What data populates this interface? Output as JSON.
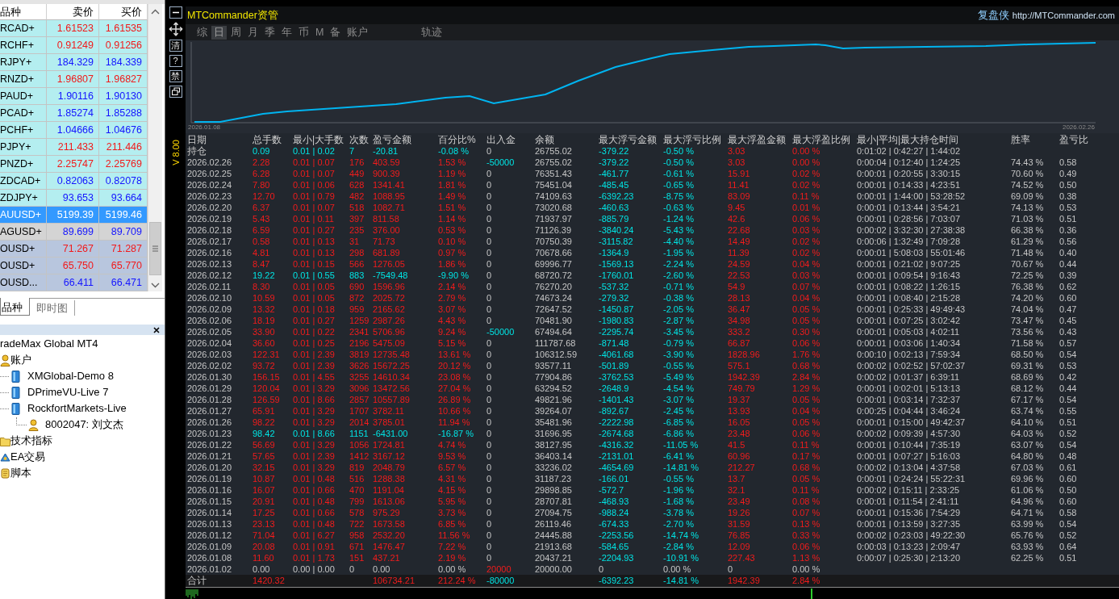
{
  "market_watch": {
    "columns": [
      "品种",
      "卖价",
      "买价"
    ],
    "rows": [
      {
        "symbol": "RCAD+",
        "bid": "1.61523",
        "ask": "1.61535",
        "rising": false,
        "color": "#b4eef0",
        "selected": false
      },
      {
        "symbol": "RCHF+",
        "bid": "0.91249",
        "ask": "0.91256",
        "rising": false,
        "color": "#b4eef0",
        "selected": false
      },
      {
        "symbol": "RJPY+",
        "bid": "184.329",
        "ask": "184.339",
        "rising": true,
        "color": "#b4eef0",
        "selected": false
      },
      {
        "symbol": "RNZD+",
        "bid": "1.96807",
        "ask": "1.96827",
        "rising": false,
        "color": "#b4eef0",
        "selected": false
      },
      {
        "symbol": "PAUD+",
        "bid": "1.90116",
        "ask": "1.90130",
        "rising": true,
        "color": "#b4eef0",
        "selected": false
      },
      {
        "symbol": "PCAD+",
        "bid": "1.85274",
        "ask": "1.85288",
        "rising": true,
        "color": "#b4eef0",
        "selected": false
      },
      {
        "symbol": "PCHF+",
        "bid": "1.04666",
        "ask": "1.04676",
        "rising": true,
        "color": "#b4eef0",
        "selected": false
      },
      {
        "symbol": "PJPY+",
        "bid": "211.433",
        "ask": "211.446",
        "rising": false,
        "color": "#b4eef0",
        "selected": false
      },
      {
        "symbol": "PNZD+",
        "bid": "2.25747",
        "ask": "2.25769",
        "rising": false,
        "color": "#b4eef0",
        "selected": false
      },
      {
        "symbol": "ZDCAD+",
        "bid": "0.82063",
        "ask": "0.82078",
        "rising": true,
        "color": "#b4eef0",
        "selected": false
      },
      {
        "symbol": "ZDJPY+",
        "bid": "93.653",
        "ask": "93.664",
        "rising": true,
        "color": "#b4eef0",
        "selected": false
      },
      {
        "symbol": "AUUSD+",
        "bid": "5199.39",
        "ask": "5199.46",
        "rising": true,
        "selected": true
      },
      {
        "symbol": "AGUSD+",
        "bid": "89.699",
        "ask": "89.709",
        "rising": true,
        "color": "#d4d4d4",
        "selected": false
      },
      {
        "symbol": "OUSD+",
        "bid": "71.267",
        "ask": "71.287",
        "rising": false,
        "color": "#b8c6de",
        "selected": false
      },
      {
        "symbol": "OUSD+",
        "bid": "65.750",
        "ask": "65.770",
        "rising": false,
        "color": "#b8c6de",
        "selected": false
      },
      {
        "symbol": "OUSD...",
        "bid": "66.411",
        "ask": "66.471",
        "rising": true,
        "color": "#b8c6de",
        "selected": false
      }
    ]
  },
  "market_tabs": [
    {
      "label": "品种",
      "selected": true
    },
    {
      "label": "即时图",
      "selected": false
    }
  ],
  "navigator": {
    "items": [
      {
        "label": "radeMax Global MT4",
        "children": [
          {
            "label": "账户",
            "kind": "accounts",
            "children": [
              {
                "label": "XMGlobal-Demo 8",
                "kind": "server"
              },
              {
                "label": "DPrimeVU-Live 7",
                "kind": "server"
              },
              {
                "label": "RockfortMarkets-Live",
                "kind": "server",
                "children": [
                  {
                    "label": "8002047: 刘文杰",
                    "kind": "account"
                  }
                ]
              }
            ]
          },
          {
            "label": "技术指标",
            "kind": "indicators"
          },
          {
            "label": "EA交易",
            "kind": "experts"
          },
          {
            "label": "脚本",
            "kind": "scripts"
          }
        ]
      }
    ]
  },
  "chart_window": {
    "toolbar": [
      {
        "kind": "minimize"
      },
      {
        "kind": "move"
      },
      {
        "kind": "text",
        "label": "清"
      },
      {
        "kind": "text",
        "label": "?"
      },
      {
        "kind": "text",
        "label": "禁"
      },
      {
        "kind": "restore"
      }
    ],
    "version": "V 8.00",
    "panel": {
      "title": "MTCommander资管",
      "brand": "复盘侠",
      "url": "http://MTCommander.com",
      "tabs": [
        {
          "label": "综",
          "selected": false
        },
        {
          "label": "日",
          "selected": true
        },
        {
          "label": "周",
          "selected": false
        },
        {
          "label": "月",
          "selected": false
        },
        {
          "label": "季",
          "selected": false
        },
        {
          "label": "年",
          "selected": false
        },
        {
          "label": "币",
          "selected": false
        },
        {
          "label": "M",
          "selected": false
        },
        {
          "label": "备",
          "selected": false
        },
        {
          "label": "账户",
          "selected": false
        },
        {
          "label": "轨迹",
          "selected": false
        }
      ],
      "chart": {
        "start_label": "2026.01.08",
        "end_label": "2026.02.26"
      },
      "table": {
        "columns": [
          "日期",
          "总手数",
          "最小|大手数",
          "次数",
          "盈亏金额",
          "百分比%",
          "出入金",
          "余额",
          "最大浮亏金额",
          "最大浮亏比例",
          "最大浮盈金额",
          "最大浮盈比例",
          "最小|平均|最大持仓时间",
          "胜率",
          "盈亏比"
        ],
        "rows": [
          {
            "date": "持仓",
            "kind": "loss",
            "lots": "0.09",
            "lots_range": "0.01 | 0.02",
            "trades": "7",
            "pnl": "-20.81",
            "pnl_pct": "-0.08 %",
            "flow": {
              "value": "0",
              "kind": "zero"
            },
            "balance": "26755.02",
            "max_loss": "-379.22",
            "max_loss_pct": "-0.50 %",
            "max_profit": "3.03",
            "max_profit_pct": "0.00 %",
            "hold_time": "0:01:02 | 0:42:27 | 1:44:02"
          },
          {
            "date": "2026.02.26",
            "kind": "profit",
            "lots": "2.28",
            "lots_range": "0.01 | 0.07",
            "trades": "176",
            "pnl": "403.59",
            "pnl_pct": "1.53 %",
            "flow": {
              "value": "-50000",
              "kind": "out"
            },
            "balance": "26755.02",
            "max_loss": "-379.22",
            "max_loss_pct": "-0.50 %",
            "max_profit": "3.03",
            "max_profit_pct": "0.00 %",
            "hold_time": "0:00:04 | 0:12:40 | 1:24:25",
            "win_rate": "74.43 %",
            "pl_ratio": "0.58"
          },
          {
            "date": "2026.02.25",
            "kind": "profit",
            "lots": "6.28",
            "lots_range": "0.01 | 0.07",
            "trades": "449",
            "pnl": "900.39",
            "pnl_pct": "1.19 %",
            "flow": {
              "value": "0",
              "kind": "zero"
            },
            "balance": "76351.43",
            "max_loss": "-461.77",
            "max_loss_pct": "-0.61 %",
            "max_profit": "15.91",
            "max_profit_pct": "0.02 %",
            "hold_time": "0:00:01 | 0:20:55 | 3:30:15",
            "win_rate": "70.60 %",
            "pl_ratio": "0.49"
          },
          {
            "date": "2026.02.24",
            "kind": "profit",
            "lots": "7.80",
            "lots_range": "0.01 | 0.06",
            "trades": "628",
            "pnl": "1341.41",
            "pnl_pct": "1.81 %",
            "flow": {
              "value": "0",
              "kind": "zero"
            },
            "balance": "75451.04",
            "max_loss": "-485.45",
            "max_loss_pct": "-0.65 %",
            "max_profit": "11.41",
            "max_profit_pct": "0.02 %",
            "hold_time": "0:00:01 | 0:14:33 | 4:23:51",
            "win_rate": "74.52 %",
            "pl_ratio": "0.50"
          },
          {
            "date": "2026.02.23",
            "kind": "profit",
            "lots": "12.70",
            "lots_range": "0.01 | 0.79",
            "trades": "482",
            "pnl": "1088.95",
            "pnl_pct": "1.49 %",
            "flow": {
              "value": "0",
              "kind": "zero"
            },
            "balance": "74109.63",
            "max_loss": "-6392.23",
            "max_loss_pct": "-8.75 %",
            "max_profit": "83.09",
            "max_profit_pct": "0.11 %",
            "hold_time": "0:00:01 | 1:44:00 | 53:28:52",
            "win_rate": "69.09 %",
            "pl_ratio": "0.38"
          },
          {
            "date": "2026.02.20",
            "kind": "profit",
            "lots": "6.37",
            "lots_range": "0.01 | 0.07",
            "trades": "518",
            "pnl": "1082.71",
            "pnl_pct": "1.51 %",
            "flow": {
              "value": "0",
              "kind": "zero"
            },
            "balance": "73020.68",
            "max_loss": "-460.63",
            "max_loss_pct": "-0.63 %",
            "max_profit": "9.45",
            "max_profit_pct": "0.01 %",
            "hold_time": "0:00:01 | 0:13:44 | 3:54:21",
            "win_rate": "74.13 %",
            "pl_ratio": "0.53"
          },
          {
            "date": "2026.02.19",
            "kind": "profit",
            "lots": "5.43",
            "lots_range": "0.01 | 0.11",
            "trades": "397",
            "pnl": "811.58",
            "pnl_pct": "1.14 %",
            "flow": {
              "value": "0",
              "kind": "zero"
            },
            "balance": "71937.97",
            "max_loss": "-885.79",
            "max_loss_pct": "-1.24 %",
            "max_profit": "42.6",
            "max_profit_pct": "0.06 %",
            "hold_time": "0:00:01 | 0:28:56 | 7:03:07",
            "win_rate": "71.03 %",
            "pl_ratio": "0.51"
          },
          {
            "date": "2026.02.18",
            "kind": "profit",
            "lots": "6.59",
            "lots_range": "0.01 | 0.27",
            "trades": "235",
            "pnl": "376.00",
            "pnl_pct": "0.53 %",
            "flow": {
              "value": "0",
              "kind": "zero"
            },
            "balance": "71126.39",
            "max_loss": "-3840.24",
            "max_loss_pct": "-5.43 %",
            "max_profit": "22.68",
            "max_profit_pct": "0.03 %",
            "hold_time": "0:00:02 | 3:32:30 | 27:38:38",
            "win_rate": "66.38 %",
            "pl_ratio": "0.36"
          },
          {
            "date": "2026.02.17",
            "kind": "profit",
            "lots": "0.58",
            "lots_range": "0.01 | 0.13",
            "trades": "31",
            "pnl": "71.73",
            "pnl_pct": "0.10 %",
            "flow": {
              "value": "0",
              "kind": "zero"
            },
            "balance": "70750.39",
            "max_loss": "-3115.82",
            "max_loss_pct": "-4.40 %",
            "max_profit": "14.49",
            "max_profit_pct": "0.02 %",
            "hold_time": "0:00:06 | 1:32:49 | 7:09:28",
            "win_rate": "61.29 %",
            "pl_ratio": "0.56"
          },
          {
            "date": "2026.02.16",
            "kind": "profit",
            "lots": "4.81",
            "lots_range": "0.01 | 0.13",
            "trades": "298",
            "pnl": "681.89",
            "pnl_pct": "0.97 %",
            "flow": {
              "value": "0",
              "kind": "zero"
            },
            "balance": "70678.66",
            "max_loss": "-1364.9",
            "max_loss_pct": "-1.95 %",
            "max_profit": "11.39",
            "max_profit_pct": "0.02 %",
            "hold_time": "0:00:01 | 5:08:03 | 55:01:46",
            "win_rate": "71.48 %",
            "pl_ratio": "0.40"
          },
          {
            "date": "2026.02.13",
            "kind": "profit",
            "lots": "8.47",
            "lots_range": "0.01 | 0.15",
            "trades": "566",
            "pnl": "1276.05",
            "pnl_pct": "1.86 %",
            "flow": {
              "value": "0",
              "kind": "zero"
            },
            "balance": "69996.77",
            "max_loss": "-1569.13",
            "max_loss_pct": "-2.24 %",
            "max_profit": "24.59",
            "max_profit_pct": "0.04 %",
            "hold_time": "0:00:01 | 0:21:02 | 9:07:25",
            "win_rate": "70.67 %",
            "pl_ratio": "0.44"
          },
          {
            "date": "2026.02.12",
            "kind": "loss",
            "lots": "19.22",
            "lots_range": "0.01 | 0.55",
            "trades": "883",
            "pnl": "-7549.48",
            "pnl_pct": "-9.90 %",
            "flow": {
              "value": "0",
              "kind": "zero"
            },
            "balance": "68720.72",
            "max_loss": "-1760.01",
            "max_loss_pct": "-2.60 %",
            "max_profit": "22.53",
            "max_profit_pct": "0.03 %",
            "hold_time": "0:00:01 | 0:09:54 | 9:16:43",
            "win_rate": "72.25 %",
            "pl_ratio": "0.39"
          },
          {
            "date": "2026.02.11",
            "kind": "profit",
            "lots": "8.30",
            "lots_range": "0.01 | 0.05",
            "trades": "690",
            "pnl": "1596.96",
            "pnl_pct": "2.14 %",
            "flow": {
              "value": "0",
              "kind": "zero"
            },
            "balance": "76270.20",
            "max_loss": "-537.32",
            "max_loss_pct": "-0.71 %",
            "max_profit": "54.9",
            "max_profit_pct": "0.07 %",
            "hold_time": "0:00:01 | 0:08:22 | 1:26:15",
            "win_rate": "76.38 %",
            "pl_ratio": "0.62"
          },
          {
            "date": "2026.02.10",
            "kind": "profit",
            "lots": "10.59",
            "lots_range": "0.01 | 0.05",
            "trades": "872",
            "pnl": "2025.72",
            "pnl_pct": "2.79 %",
            "flow": {
              "value": "0",
              "kind": "zero"
            },
            "balance": "74673.24",
            "max_loss": "-279.32",
            "max_loss_pct": "-0.38 %",
            "max_profit": "28.13",
            "max_profit_pct": "0.04 %",
            "hold_time": "0:00:01 | 0:08:40 | 2:15:28",
            "win_rate": "74.20 %",
            "pl_ratio": "0.60"
          },
          {
            "date": "2026.02.09",
            "kind": "profit",
            "lots": "13.32",
            "lots_range": "0.01 | 0.18",
            "trades": "959",
            "pnl": "2165.62",
            "pnl_pct": "3.07 %",
            "flow": {
              "value": "0",
              "kind": "zero"
            },
            "balance": "72647.52",
            "max_loss": "-1450.87",
            "max_loss_pct": "-2.05 %",
            "max_profit": "36.47",
            "max_profit_pct": "0.05 %",
            "hold_time": "0:00:01 | 0:25:33 | 49:49:43",
            "win_rate": "74.04 %",
            "pl_ratio": "0.47"
          },
          {
            "date": "2026.02.06",
            "kind": "profit",
            "lots": "18.19",
            "lots_range": "0.01 | 0.27",
            "trades": "1259",
            "pnl": "2987.26",
            "pnl_pct": "4.43 %",
            "flow": {
              "value": "0",
              "kind": "zero"
            },
            "balance": "70481.90",
            "max_loss": "-1980.83",
            "max_loss_pct": "-2.87 %",
            "max_profit": "34.98",
            "max_profit_pct": "0.05 %",
            "hold_time": "0:00:01 | 0:07:25 | 3:02:42",
            "win_rate": "73.47 %",
            "pl_ratio": "0.45"
          },
          {
            "date": "2026.02.05",
            "kind": "profit",
            "lots": "33.90",
            "lots_range": "0.01 | 0.22",
            "trades": "2341",
            "pnl": "5706.96",
            "pnl_pct": "9.24 %",
            "flow": {
              "value": "-50000",
              "kind": "out"
            },
            "balance": "67494.64",
            "max_loss": "-2295.74",
            "max_loss_pct": "-3.45 %",
            "max_profit": "333.2",
            "max_profit_pct": "0.30 %",
            "hold_time": "0:00:01 | 0:05:03 | 4:02:11",
            "win_rate": "73.56 %",
            "pl_ratio": "0.43"
          },
          {
            "date": "2026.02.04",
            "kind": "profit",
            "lots": "36.60",
            "lots_range": "0.01 | 0.25",
            "trades": "2196",
            "pnl": "5475.09",
            "pnl_pct": "5.15 %",
            "flow": {
              "value": "0",
              "kind": "zero"
            },
            "balance": "111787.68",
            "max_loss": "-871.48",
            "max_loss_pct": "-0.79 %",
            "max_profit": "66.87",
            "max_profit_pct": "0.06 %",
            "hold_time": "0:00:01 | 0:03:06 | 1:40:34",
            "win_rate": "71.58 %",
            "pl_ratio": "0.57"
          },
          {
            "date": "2026.02.03",
            "kind": "profit",
            "lots": "122.31",
            "lots_range": "0.01 | 2.39",
            "trades": "3819",
            "pnl": "12735.48",
            "pnl_pct": "13.61 %",
            "flow": {
              "value": "0",
              "kind": "zero"
            },
            "balance": "106312.59",
            "max_loss": "-4061.68",
            "max_loss_pct": "-3.90 %",
            "max_profit": "1828.96",
            "max_profit_pct": "1.76 %",
            "hold_time": "0:00:10 | 0:02:13 | 7:59:34",
            "win_rate": "68.50 %",
            "pl_ratio": "0.54"
          },
          {
            "date": "2026.02.02",
            "kind": "profit",
            "lots": "93.72",
            "lots_range": "0.01 | 2.39",
            "trades": "3626",
            "pnl": "15672.25",
            "pnl_pct": "20.12 %",
            "flow": {
              "value": "0",
              "kind": "zero"
            },
            "balance": "93577.11",
            "max_loss": "-501.89",
            "max_loss_pct": "-0.55 %",
            "max_profit": "575.1",
            "max_profit_pct": "0.68 %",
            "hold_time": "0:00:02 | 0:02:52 | 57:02:37",
            "win_rate": "69.31 %",
            "pl_ratio": "0.53"
          },
          {
            "date": "2026.01.30",
            "kind": "profit",
            "lots": "156.15",
            "lots_range": "0.01 | 4.55",
            "trades": "3255",
            "pnl": "14610.34",
            "pnl_pct": "23.08 %",
            "flow": {
              "value": "0",
              "kind": "zero"
            },
            "balance": "77904.86",
            "max_loss": "-3762.53",
            "max_loss_pct": "-5.49 %",
            "max_profit": "1942.39",
            "max_profit_pct": "2.84 %",
            "hold_time": "0:00:02 | 0:01:37 | 6:39:11",
            "win_rate": "68.69 %",
            "pl_ratio": "0.42"
          },
          {
            "date": "2026.01.29",
            "kind": "profit",
            "lots": "120.04",
            "lots_range": "0.01 | 3.29",
            "trades": "3096",
            "pnl": "13472.56",
            "pnl_pct": "27.04 %",
            "flow": {
              "value": "0",
              "kind": "zero"
            },
            "balance": "63294.52",
            "max_loss": "-2648.9",
            "max_loss_pct": "-4.54 %",
            "max_profit": "749.79",
            "max_profit_pct": "1.29 %",
            "hold_time": "0:00:01 | 0:02:01 | 5:13:13",
            "win_rate": "68.12 %",
            "pl_ratio": "0.44"
          },
          {
            "date": "2026.01.28",
            "kind": "profit",
            "lots": "126.59",
            "lots_range": "0.01 | 8.66",
            "trades": "2857",
            "pnl": "10557.89",
            "pnl_pct": "26.89 %",
            "flow": {
              "value": "0",
              "kind": "zero"
            },
            "balance": "49821.96",
            "max_loss": "-1401.43",
            "max_loss_pct": "-3.07 %",
            "max_profit": "19.37",
            "max_profit_pct": "0.05 %",
            "hold_time": "0:00:01 | 0:03:14 | 7:32:37",
            "win_rate": "67.17 %",
            "pl_ratio": "0.54"
          },
          {
            "date": "2026.01.27",
            "kind": "profit",
            "lots": "65.91",
            "lots_range": "0.01 | 3.29",
            "trades": "1707",
            "pnl": "3782.11",
            "pnl_pct": "10.66 %",
            "flow": {
              "value": "0",
              "kind": "zero"
            },
            "balance": "39264.07",
            "max_loss": "-892.67",
            "max_loss_pct": "-2.45 %",
            "max_profit": "13.93",
            "max_profit_pct": "0.04 %",
            "hold_time": "0:00:25 | 0:04:44 | 3:46:24",
            "win_rate": "63.74 %",
            "pl_ratio": "0.55"
          },
          {
            "date": "2026.01.26",
            "kind": "profit",
            "lots": "98.22",
            "lots_range": "0.01 | 3.29",
            "trades": "2014",
            "pnl": "3785.01",
            "pnl_pct": "11.94 %",
            "flow": {
              "value": "0",
              "kind": "zero"
            },
            "balance": "35481.96",
            "max_loss": "-2222.98",
            "max_loss_pct": "-6.85 %",
            "max_profit": "16.05",
            "max_profit_pct": "0.05 %",
            "hold_time": "0:00:01 | 0:15:00 | 49:42:37",
            "win_rate": "64.10 %",
            "pl_ratio": "0.51"
          },
          {
            "date": "2026.01.23",
            "kind": "loss",
            "lots": "98.42",
            "lots_range": "0.01 | 8.66",
            "trades": "1151",
            "pnl": "-6431.00",
            "pnl_pct": "-16.87 %",
            "flow": {
              "value": "0",
              "kind": "zero"
            },
            "balance": "31696.95",
            "max_loss": "-2674.68",
            "max_loss_pct": "-6.86 %",
            "max_profit": "23.48",
            "max_profit_pct": "0.06 %",
            "hold_time": "0:00:02 | 0:09:39 | 4:57:30",
            "win_rate": "64.03 %",
            "pl_ratio": "0.52"
          },
          {
            "date": "2026.01.22",
            "kind": "profit",
            "lots": "56.69",
            "lots_range": "0.01 | 3.29",
            "trades": "1056",
            "pnl": "1724.81",
            "pnl_pct": "4.74 %",
            "flow": {
              "value": "0",
              "kind": "zero"
            },
            "balance": "38127.95",
            "max_loss": "-4316.32",
            "max_loss_pct": "-11.05 %",
            "max_profit": "41.5",
            "max_profit_pct": "0.11 %",
            "hold_time": "0:00:01 | 0:10:44 | 7:35:19",
            "win_rate": "63.07 %",
            "pl_ratio": "0.54"
          },
          {
            "date": "2026.01.21",
            "kind": "profit",
            "lots": "57.65",
            "lots_range": "0.01 | 2.39",
            "trades": "1412",
            "pnl": "3167.12",
            "pnl_pct": "9.53 %",
            "flow": {
              "value": "0",
              "kind": "zero"
            },
            "balance": "36403.14",
            "max_loss": "-2131.01",
            "max_loss_pct": "-6.41 %",
            "max_profit": "60.96",
            "max_profit_pct": "0.17 %",
            "hold_time": "0:00:01 | 0:07:27 | 5:16:03",
            "win_rate": "64.80 %",
            "pl_ratio": "0.48"
          },
          {
            "date": "2026.01.20",
            "kind": "profit",
            "lots": "32.15",
            "lots_range": "0.01 | 3.29",
            "trades": "819",
            "pnl": "2048.79",
            "pnl_pct": "6.57 %",
            "flow": {
              "value": "0",
              "kind": "zero"
            },
            "balance": "33236.02",
            "max_loss": "-4654.69",
            "max_loss_pct": "-14.81 %",
            "max_profit": "212.27",
            "max_profit_pct": "0.68 %",
            "hold_time": "0:00:02 | 0:13:04 | 4:37:58",
            "win_rate": "67.03 %",
            "pl_ratio": "0.61"
          },
          {
            "date": "2026.01.19",
            "kind": "profit",
            "lots": "10.87",
            "lots_range": "0.01 | 0.48",
            "trades": "516",
            "pnl": "1288.38",
            "pnl_pct": "4.31 %",
            "flow": {
              "value": "0",
              "kind": "zero"
            },
            "balance": "31187.23",
            "max_loss": "-166.01",
            "max_loss_pct": "-0.55 %",
            "max_profit": "13.7",
            "max_profit_pct": "0.05 %",
            "hold_time": "0:00:01 | 0:24:24 | 55:22:31",
            "win_rate": "69.96 %",
            "pl_ratio": "0.60"
          },
          {
            "date": "2026.01.16",
            "kind": "profit",
            "lots": "16.07",
            "lots_range": "0.01 | 0.66",
            "trades": "470",
            "pnl": "1191.04",
            "pnl_pct": "4.15 %",
            "flow": {
              "value": "0",
              "kind": "zero"
            },
            "balance": "29898.85",
            "max_loss": "-572.7",
            "max_loss_pct": "-1.96 %",
            "max_profit": "32.1",
            "max_profit_pct": "0.11 %",
            "hold_time": "0:00:02 | 0:15:11 | 2:33:25",
            "win_rate": "61.06 %",
            "pl_ratio": "0.50"
          },
          {
            "date": "2026.01.15",
            "kind": "profit",
            "lots": "20.91",
            "lots_range": "0.01 | 0.48",
            "trades": "799",
            "pnl": "1613.06",
            "pnl_pct": "5.95 %",
            "flow": {
              "value": "0",
              "kind": "zero"
            },
            "balance": "28707.81",
            "max_loss": "-468.93",
            "max_loss_pct": "-1.68 %",
            "max_profit": "23.49",
            "max_profit_pct": "0.08 %",
            "hold_time": "0:00:01 | 0:11:54 | 2:41:11",
            "win_rate": "64.96 %",
            "pl_ratio": "0.60"
          },
          {
            "date": "2026.01.14",
            "kind": "profit",
            "lots": "17.25",
            "lots_range": "0.01 | 0.66",
            "trades": "578",
            "pnl": "975.29",
            "pnl_pct": "3.73 %",
            "flow": {
              "value": "0",
              "kind": "zero"
            },
            "balance": "27094.75",
            "max_loss": "-988.24",
            "max_loss_pct": "-3.78 %",
            "max_profit": "19.26",
            "max_profit_pct": "0.07 %",
            "hold_time": "0:00:01 | 0:15:36 | 7:54:29",
            "win_rate": "64.71 %",
            "pl_ratio": "0.58"
          },
          {
            "date": "2026.01.13",
            "kind": "profit",
            "lots": "23.13",
            "lots_range": "0.01 | 0.48",
            "trades": "722",
            "pnl": "1673.58",
            "pnl_pct": "6.85 %",
            "flow": {
              "value": "0",
              "kind": "zero"
            },
            "balance": "26119.46",
            "max_loss": "-674.33",
            "max_loss_pct": "-2.70 %",
            "max_profit": "31.59",
            "max_profit_pct": "0.13 %",
            "hold_time": "0:00:01 | 0:13:59 | 3:27:35",
            "win_rate": "63.99 %",
            "pl_ratio": "0.54"
          },
          {
            "date": "2026.01.12",
            "kind": "profit",
            "lots": "71.04",
            "lots_range": "0.01 | 6.27",
            "trades": "958",
            "pnl": "2532.20",
            "pnl_pct": "11.56 %",
            "flow": {
              "value": "0",
              "kind": "zero"
            },
            "balance": "24445.88",
            "max_loss": "-2253.56",
            "max_loss_pct": "-14.74 %",
            "max_profit": "76.85",
            "max_profit_pct": "0.33 %",
            "hold_time": "0:00:02 | 0:23:03 | 49:22:30",
            "win_rate": "65.76 %",
            "pl_ratio": "0.52"
          },
          {
            "date": "2026.01.09",
            "kind": "profit",
            "lots": "20.08",
            "lots_range": "0.01 | 0.91",
            "trades": "671",
            "pnl": "1476.47",
            "pnl_pct": "7.22 %",
            "flow": {
              "value": "0",
              "kind": "zero"
            },
            "balance": "21913.68",
            "max_loss": "-584.65",
            "max_loss_pct": "-2.84 %",
            "max_profit": "12.09",
            "max_profit_pct": "0.06 %",
            "hold_time": "0:00:03 | 0:13:23 | 2:09:47",
            "win_rate": "63.93 %",
            "pl_ratio": "0.64"
          },
          {
            "date": "2026.01.08",
            "kind": "profit",
            "lots": "11.60",
            "lots_range": "0.01 | 1.73",
            "trades": "151",
            "pnl": "437.21",
            "pnl_pct": "2.19 %",
            "flow": {
              "value": "0",
              "kind": "zero"
            },
            "balance": "20437.21",
            "max_loss": "-2204.93",
            "max_loss_pct": "-10.91 %",
            "max_profit": "227.43",
            "max_profit_pct": "1.13 %",
            "hold_time": "0:00:07 | 0:25:30 | 2:13:20",
            "win_rate": "62.25 %",
            "pl_ratio": "0.51"
          },
          {
            "date": "2026.01.02",
            "kind": "flat",
            "lots": "0.00",
            "lots_range": "0.00 | 0.00",
            "trades": "0",
            "pnl": "0.00",
            "pnl_pct": "0.00 %",
            "flow": {
              "value": "20000",
              "kind": "in"
            },
            "balance": "20000.00",
            "max_loss": "0",
            "max_loss_pct": "0.00 %",
            "max_profit": "0",
            "max_profit_pct": "0.00 %"
          }
        ],
        "total": {
          "date": "合计",
          "kind": "profit",
          "lots": "1420.32",
          "pnl": "106734.21",
          "pnl_pct": "212.24 %",
          "flow": {
            "value": "-80000",
            "kind": "out"
          },
          "max_loss": "-6392.23",
          "max_loss_pct": "-14.81 %",
          "max_profit": "1942.39",
          "max_profit_pct": "2.84 %"
        }
      }
    }
  }
}
